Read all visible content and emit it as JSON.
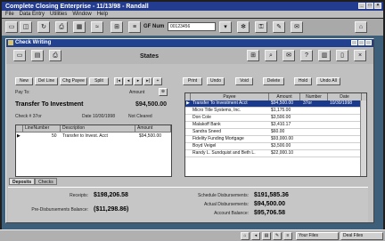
{
  "app": {
    "title": "Complete Closing Enterprise - 11/13/98 - Randall",
    "menu": [
      "File",
      "Data Entry",
      "Utilities",
      "Window",
      "Help"
    ],
    "gf_label": "GF Num",
    "gf_value": "00123456"
  },
  "window": {
    "title": "Check Writing",
    "section": "States"
  },
  "left_buttons": [
    "New",
    "Del Line",
    "Chg Payee",
    "Split"
  ],
  "right_buttons": [
    "Print",
    "Undo",
    "Void",
    "Delete",
    "Hold",
    "Undo All"
  ],
  "check": {
    "pay_to_label": "Pay To:",
    "payee": "Transfer To Investment",
    "amount_label": "Amount",
    "amount": "$94,500.00",
    "check_num_label": "Check # 37or",
    "date_label": "Date 10/30/1998",
    "status_label": "Not Cleared"
  },
  "line_table": {
    "headers": [
      "LineNumber",
      "Description",
      "Amount"
    ],
    "rows": [
      {
        "line": "50",
        "desc": "Transfer to Invest. Acct",
        "amount": "$94,500.00"
      }
    ]
  },
  "tabs": [
    "Deposits",
    "Checks"
  ],
  "payees_table": {
    "headers": [
      "Payee",
      "Amount",
      "Number",
      "Date"
    ],
    "rows": [
      {
        "payee": "Transfer To Investment Acct",
        "amount": "$94,500.00",
        "number": "37or",
        "date": "10/30/1998",
        "selected": true
      },
      {
        "payee": "Micro Title Systems, Inc.",
        "amount": "$1,175.00",
        "number": "",
        "date": ""
      },
      {
        "payee": "Don Cole",
        "amount": "$3,500.00",
        "number": "",
        "date": ""
      },
      {
        "payee": "Malakoff Bank",
        "amount": "$3,410.17",
        "number": "",
        "date": ""
      },
      {
        "payee": "Sandra Sneed",
        "amount": "$60.00",
        "number": "",
        "date": ""
      },
      {
        "payee": "Fidelity Funding Mortgage",
        "amount": "$93,000.00",
        "number": "",
        "date": ""
      },
      {
        "payee": "Boyd Veigel",
        "amount": "$3,500.00",
        "number": "",
        "date": ""
      },
      {
        "payee": "Randy L. Sundquist and Beth L.",
        "amount": "$22,000.10",
        "number": "",
        "date": ""
      }
    ]
  },
  "summary": {
    "receipts_label": "Receipts:",
    "receipts": "$198,206.58",
    "pre_label": "Pre-Disbursements Balance:",
    "pre": "($11,298.86)",
    "sched_label": "Schedule Disbursements:",
    "sched": "$191,585.36",
    "actual_label": "Actual Disbursements:",
    "actual": "$94,500.00",
    "account_label": "Account Balance:",
    "account": "$95,706.58"
  },
  "taskbar": {
    "item1": "Your Files",
    "item2": "Deal Files"
  }
}
